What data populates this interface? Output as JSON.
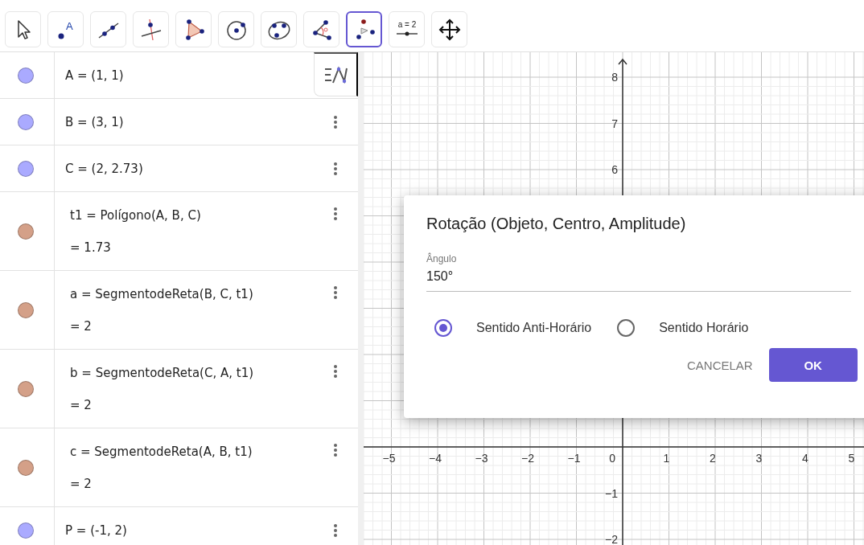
{
  "toolbar": {
    "tools": [
      {
        "kind": "move",
        "selected": false
      },
      {
        "kind": "point",
        "selected": false,
        "label": "A"
      },
      {
        "kind": "line",
        "selected": false
      },
      {
        "kind": "perpendicular",
        "selected": false
      },
      {
        "kind": "polygon",
        "selected": false
      },
      {
        "kind": "circle",
        "selected": false
      },
      {
        "kind": "conic",
        "selected": false
      },
      {
        "kind": "angle",
        "selected": false
      },
      {
        "kind": "rotate",
        "selected": true
      },
      {
        "kind": "slider",
        "selected": false,
        "label": "a = 2"
      },
      {
        "kind": "pan",
        "selected": false
      }
    ]
  },
  "algebra": {
    "items": [
      {
        "definition": "A = (1, 1)",
        "color": "#aaaaff"
      },
      {
        "definition": "B = (3, 1)",
        "color": "#aaaaff"
      },
      {
        "definition": "C = (2, 2.73)",
        "color": "#aaaaff"
      },
      {
        "definition": "t1 = Polígono(A, B, C)",
        "value": "= 1.73",
        "color": "#d4a088"
      },
      {
        "definition": "a = SegmentodeReta(B, C, t1)",
        "value": "= 2",
        "color": "#d4a088"
      },
      {
        "definition": "b = SegmentodeReta(C, A, t1)",
        "value": "= 2",
        "color": "#d4a088"
      },
      {
        "definition": "c = SegmentodeReta(A, B, t1)",
        "value": "= 2",
        "color": "#d4a088"
      },
      {
        "definition": "P = (-1, 2)",
        "color": "#aaaaff"
      }
    ]
  },
  "graphics": {
    "x_labels": [
      "−5",
      "−4",
      "−3",
      "−2",
      "−1",
      "1",
      "2",
      "3",
      "4",
      "5"
    ],
    "origin_label": "0",
    "y_labels": [
      "8",
      "7",
      "6",
      "−1",
      "−2"
    ]
  },
  "dialog": {
    "title": "Rotação (Objeto, Centro, Amplitude)",
    "field": {
      "label": "Ângulo",
      "value": "150°"
    },
    "radios": [
      {
        "label": "Sentido Anti-Horário",
        "selected": true
      },
      {
        "label": "Sentido Horário",
        "selected": false
      }
    ],
    "buttons": [
      {
        "label": "CANCELAR",
        "kind": "text"
      },
      {
        "label": "OK",
        "kind": "primary"
      }
    ]
  }
}
